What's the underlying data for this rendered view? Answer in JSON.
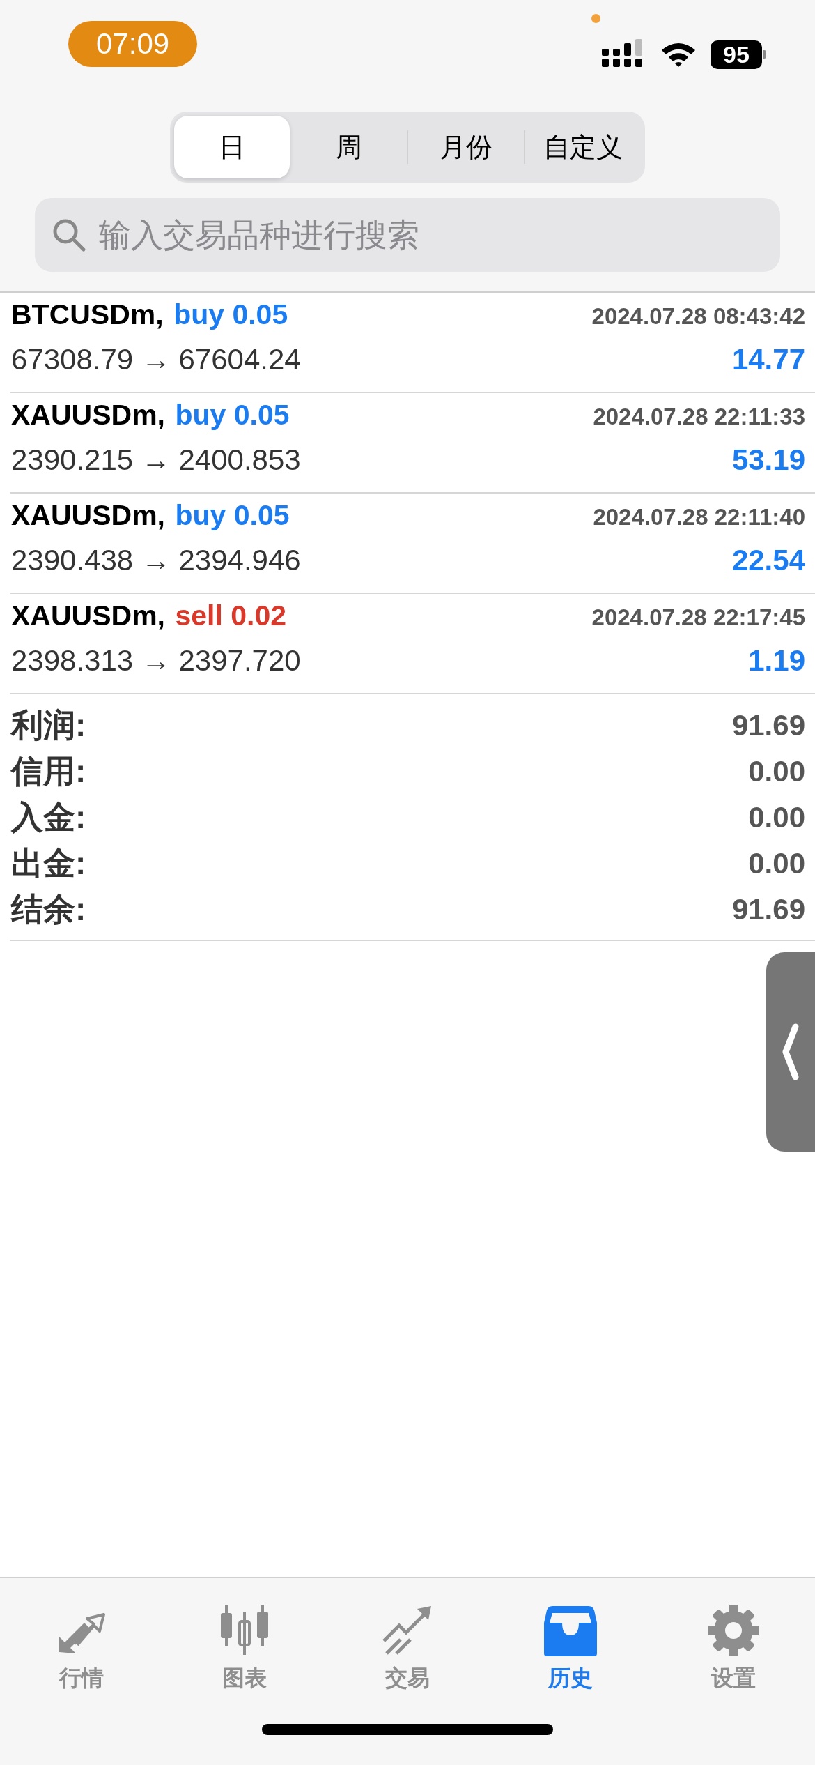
{
  "status_bar": {
    "time": "07:09",
    "battery": "95"
  },
  "tabs": [
    {
      "label": "日",
      "selected": true
    },
    {
      "label": "周",
      "selected": false
    },
    {
      "label": "月份",
      "selected": false
    },
    {
      "label": "自定义",
      "selected": false
    }
  ],
  "search": {
    "placeholder": "输入交易品种进行搜索"
  },
  "deals": [
    {
      "symbol": "BTCUSDm,",
      "side": "buy",
      "volume": "0.05",
      "time": "2024.07.28 08:43:42",
      "prices": "67308.79 → 67604.24",
      "profit": "14.77"
    },
    {
      "symbol": "XAUUSDm,",
      "side": "buy",
      "volume": "0.05",
      "time": "2024.07.28 22:11:33",
      "prices": "2390.215 → 2400.853",
      "profit": "53.19"
    },
    {
      "symbol": "XAUUSDm,",
      "side": "buy",
      "volume": "0.05",
      "time": "2024.07.28 22:11:40",
      "prices": "2390.438 → 2394.946",
      "profit": "22.54"
    },
    {
      "symbol": "XAUUSDm,",
      "side": "sell",
      "volume": "0.02",
      "time": "2024.07.28 22:17:45",
      "prices": "2398.313 → 2397.720",
      "profit": "1.19"
    }
  ],
  "summary": [
    {
      "label": "利润:",
      "value": "91.69"
    },
    {
      "label": "信用:",
      "value": "0.00"
    },
    {
      "label": "入金:",
      "value": "0.00"
    },
    {
      "label": "出金:",
      "value": "0.00"
    },
    {
      "label": "结余:",
      "value": "91.69"
    }
  ],
  "nav": [
    {
      "kind": "quotes",
      "label": "行情",
      "selected": false
    },
    {
      "kind": "chart",
      "label": "图表",
      "selected": false
    },
    {
      "kind": "trade",
      "label": "交易",
      "selected": false
    },
    {
      "kind": "history",
      "label": "历史",
      "selected": true
    },
    {
      "kind": "settings",
      "label": "设置",
      "selected": false
    }
  ]
}
